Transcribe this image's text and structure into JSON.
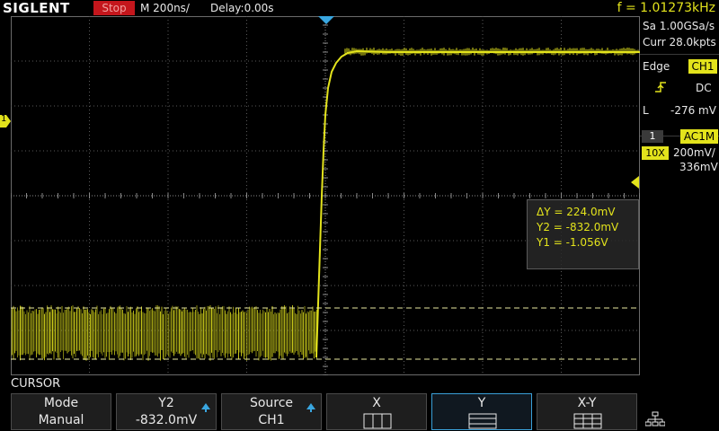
{
  "header": {
    "brand": "SIGLENT",
    "run_state": "Stop",
    "timebase": "M 200ns/",
    "delay": "Delay:0.00s",
    "frequency": "f = 1.01273kHz"
  },
  "acquisition": {
    "sample_rate": "Sa 1.00GSa/s",
    "memory": "Curr 28.0kpts"
  },
  "trigger": {
    "type": "Edge",
    "source": "CH1",
    "slope_icon": "rising-edge-icon",
    "coupling": "DC",
    "level_label": "L",
    "level": "-276 mV"
  },
  "channel": {
    "number": "1",
    "coupling": "AC1M",
    "probe": "10X",
    "scale": "200mV/",
    "offset": "336mV",
    "marker": "1"
  },
  "cursor_readout": {
    "delta_y": "ΔY = 224.0mV",
    "y2": "Y2 = -832.0mV",
    "y1": "Y1 = -1.056V"
  },
  "menu": {
    "title": "CURSOR",
    "softkeys": [
      {
        "label": "Mode",
        "value": "Manual"
      },
      {
        "label": "Y2",
        "value": "-832.0mV"
      },
      {
        "label": "Source",
        "value": "CH1"
      },
      {
        "label": "X",
        "value": ""
      },
      {
        "label": "Y",
        "value": ""
      },
      {
        "label": "X-Y",
        "value": ""
      }
    ]
  },
  "colors": {
    "trace": "#e3e31c",
    "stop": "#c4161c",
    "selected_key": "#3aa0d8"
  }
}
